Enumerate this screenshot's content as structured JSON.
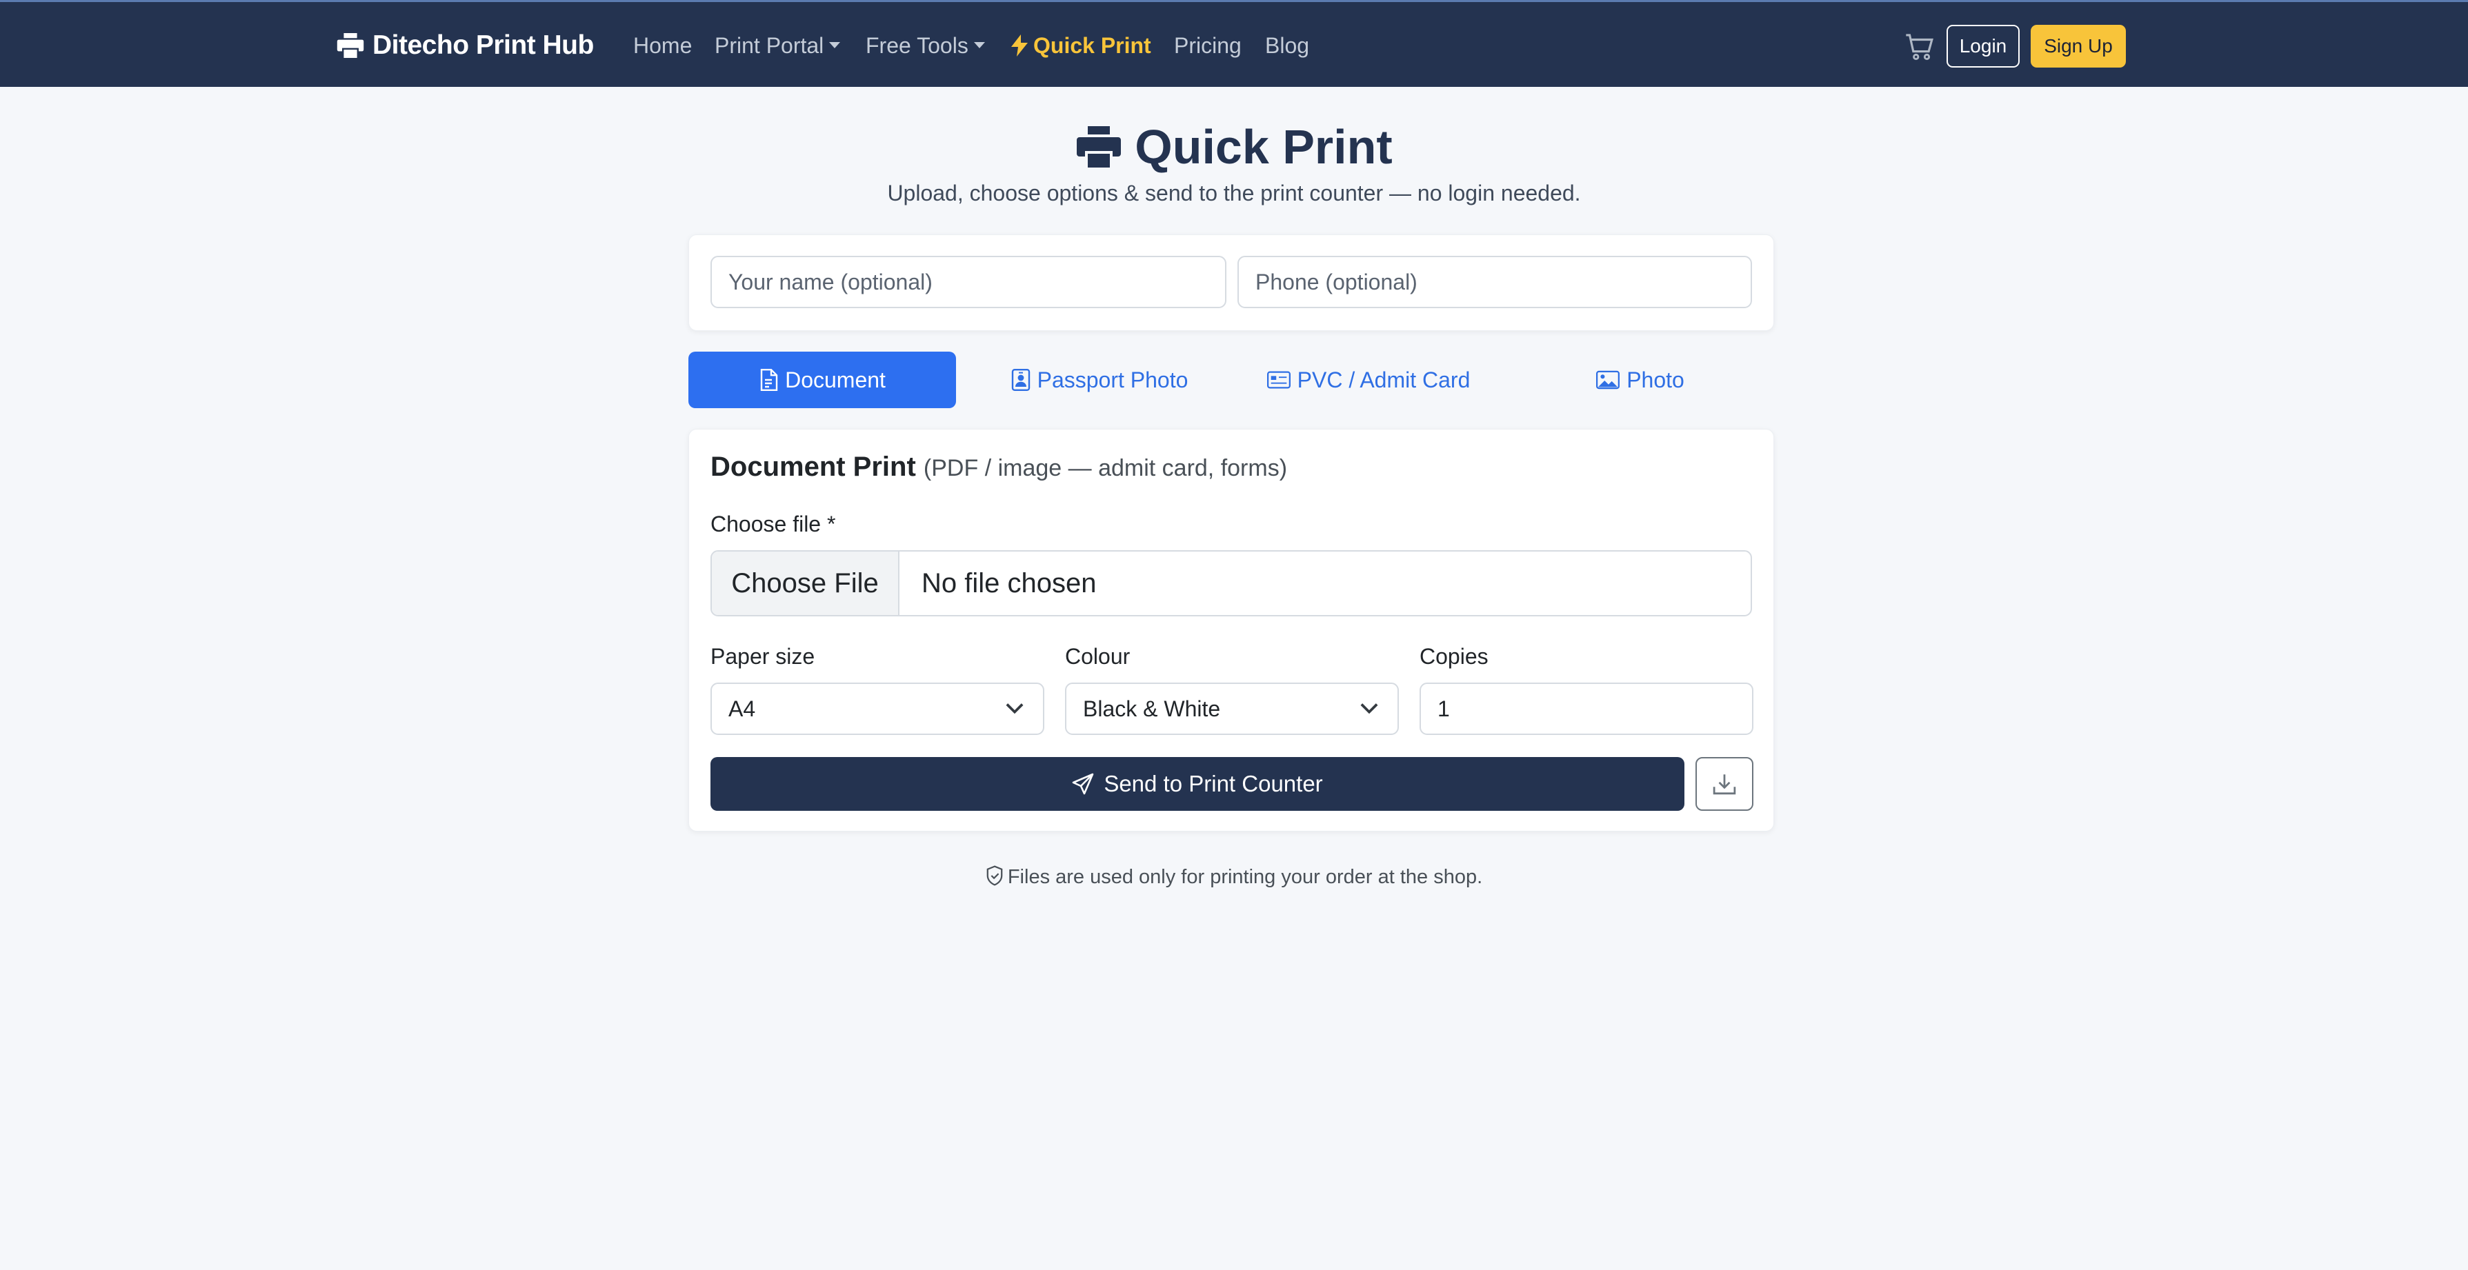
{
  "nav": {
    "brand": "Ditecho Print Hub",
    "links": {
      "home": "Home",
      "print_portal": "Print Portal",
      "free_tools": "Free Tools",
      "quick_print": "Quick Print",
      "pricing": "Pricing",
      "blog": "Blog"
    },
    "login": "Login",
    "signup": "Sign Up",
    "accent_color": "#f8c43a",
    "bg_color": "#243350"
  },
  "header": {
    "title": "Quick Print",
    "subtitle": "Upload, choose options & send to the print counter — no login needed."
  },
  "contact": {
    "name_placeholder": "Your name (optional)",
    "phone_placeholder": "Phone (optional)"
  },
  "tabs": [
    {
      "label": "Document",
      "icon": "file-icon",
      "active": true
    },
    {
      "label": "Passport Photo",
      "icon": "person-badge-icon",
      "active": false
    },
    {
      "label": "PVC / Admit Card",
      "icon": "card-icon",
      "active": false
    },
    {
      "label": "Photo",
      "icon": "image-icon",
      "active": false
    }
  ],
  "document": {
    "title": "Document Print",
    "subtitle": "(PDF / image — admit card, forms)",
    "file_label": "Choose file *",
    "file_button": "Choose File",
    "file_status": "No file chosen",
    "paper_label": "Paper size",
    "paper_value": "A4",
    "colour_label": "Colour",
    "colour_value": "Black & White",
    "copies_label": "Copies",
    "copies_value": "1",
    "send_button": "Send to Print Counter"
  },
  "footer_note": "Files are used only for printing your order at the shop."
}
